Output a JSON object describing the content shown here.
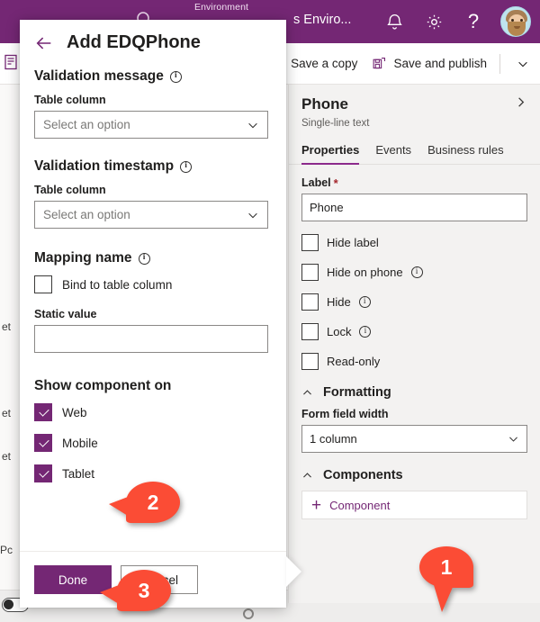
{
  "topbar": {
    "env_label": "Environment",
    "env_name": "s Enviro...",
    "search_icon": "search-icon",
    "bell_icon": "bell-notification-icon",
    "settings_icon": "gear-icon",
    "help_icon": "question-mark-help-icon",
    "avatar": "user-avatar"
  },
  "commandbar": {
    "save_a_copy": "Save a copy",
    "save_and_publish": "Save and publish",
    "publish_icon": "save-and-publish-icon",
    "overflow_caret": "chevron-down-icon"
  },
  "background_fragments": {
    "rail_icon": "form-designer-icon",
    "f1": "et",
    "f2": "et",
    "f3": "et",
    "f4": "Pc"
  },
  "properties_pane": {
    "title": "Phone",
    "subtitle": "Single-line text",
    "expand_icon": "chevron-right-icon",
    "tabs": [
      {
        "label": "Properties",
        "active": true
      },
      {
        "label": "Events",
        "active": false
      },
      {
        "label": "Business rules",
        "active": false
      }
    ],
    "label_field": {
      "label": "Label",
      "required_mark": "*",
      "value": "Phone"
    },
    "checkboxes": [
      {
        "label": "Hide label",
        "checked": false,
        "info": false
      },
      {
        "label": "Hide on phone",
        "checked": false,
        "info": true
      },
      {
        "label": "Hide",
        "checked": false,
        "info": true
      },
      {
        "label": "Lock",
        "checked": false,
        "info": true
      },
      {
        "label": "Read-only",
        "checked": false,
        "info": false
      }
    ],
    "formatting": {
      "section_title": "Formatting",
      "field_label": "Form field width",
      "value": "1 column"
    },
    "components": {
      "section_title": "Components",
      "add_label": "Component",
      "add_icon": "plus-icon"
    }
  },
  "flyout": {
    "back_icon": "back-arrow-icon",
    "title": "Add EDQPhone",
    "sections": {
      "validation_message": {
        "heading": "Validation message",
        "field_label": "Table column",
        "placeholder": "Select an option"
      },
      "validation_timestamp": {
        "heading": "Validation timestamp",
        "field_label": "Table column",
        "placeholder": "Select an option"
      },
      "mapping_name": {
        "heading": "Mapping name",
        "bind_label": "Bind to table column",
        "bind_checked": false,
        "static_label": "Static value",
        "static_value": ""
      },
      "show_component_on": {
        "heading": "Show component on",
        "options": [
          {
            "label": "Web",
            "checked": true
          },
          {
            "label": "Mobile",
            "checked": true
          },
          {
            "label": "Tablet",
            "checked": true
          }
        ]
      }
    },
    "footer": {
      "done_label": "Done",
      "cancel_label": "Cancel"
    }
  },
  "annotations": [
    {
      "number": "1",
      "target": "components-add-component"
    },
    {
      "number": "2",
      "target": "mobile-checkbox"
    },
    {
      "number": "3",
      "target": "done-button"
    }
  ],
  "colors": {
    "brand_purple": "#742774",
    "tab_accent": "#8c2a8c",
    "annotation_red": "#fb4c35",
    "required_red": "#a4262c",
    "pane_background": "#f3f2f1"
  }
}
